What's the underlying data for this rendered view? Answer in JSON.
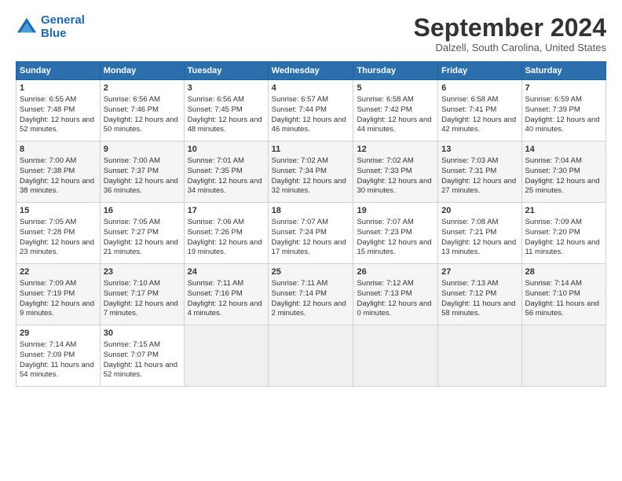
{
  "logo": {
    "line1": "General",
    "line2": "Blue"
  },
  "title": "September 2024",
  "location": "Dalzell, South Carolina, United States",
  "headers": [
    "Sunday",
    "Monday",
    "Tuesday",
    "Wednesday",
    "Thursday",
    "Friday",
    "Saturday"
  ],
  "rows": [
    [
      {
        "day": "1",
        "sunrise": "6:55 AM",
        "sunset": "7:48 PM",
        "daylight": "12 hours and 52 minutes."
      },
      {
        "day": "2",
        "sunrise": "6:56 AM",
        "sunset": "7:46 PM",
        "daylight": "12 hours and 50 minutes."
      },
      {
        "day": "3",
        "sunrise": "6:56 AM",
        "sunset": "7:45 PM",
        "daylight": "12 hours and 48 minutes."
      },
      {
        "day": "4",
        "sunrise": "6:57 AM",
        "sunset": "7:44 PM",
        "daylight": "12 hours and 46 minutes."
      },
      {
        "day": "5",
        "sunrise": "6:58 AM",
        "sunset": "7:42 PM",
        "daylight": "12 hours and 44 minutes."
      },
      {
        "day": "6",
        "sunrise": "6:58 AM",
        "sunset": "7:41 PM",
        "daylight": "12 hours and 42 minutes."
      },
      {
        "day": "7",
        "sunrise": "6:59 AM",
        "sunset": "7:39 PM",
        "daylight": "12 hours and 40 minutes."
      }
    ],
    [
      {
        "day": "8",
        "sunrise": "7:00 AM",
        "sunset": "7:38 PM",
        "daylight": "12 hours and 38 minutes."
      },
      {
        "day": "9",
        "sunrise": "7:00 AM",
        "sunset": "7:37 PM",
        "daylight": "12 hours and 36 minutes."
      },
      {
        "day": "10",
        "sunrise": "7:01 AM",
        "sunset": "7:35 PM",
        "daylight": "12 hours and 34 minutes."
      },
      {
        "day": "11",
        "sunrise": "7:02 AM",
        "sunset": "7:34 PM",
        "daylight": "12 hours and 32 minutes."
      },
      {
        "day": "12",
        "sunrise": "7:02 AM",
        "sunset": "7:33 PM",
        "daylight": "12 hours and 30 minutes."
      },
      {
        "day": "13",
        "sunrise": "7:03 AM",
        "sunset": "7:31 PM",
        "daylight": "12 hours and 27 minutes."
      },
      {
        "day": "14",
        "sunrise": "7:04 AM",
        "sunset": "7:30 PM",
        "daylight": "12 hours and 25 minutes."
      }
    ],
    [
      {
        "day": "15",
        "sunrise": "7:05 AM",
        "sunset": "7:28 PM",
        "daylight": "12 hours and 23 minutes."
      },
      {
        "day": "16",
        "sunrise": "7:05 AM",
        "sunset": "7:27 PM",
        "daylight": "12 hours and 21 minutes."
      },
      {
        "day": "17",
        "sunrise": "7:06 AM",
        "sunset": "7:26 PM",
        "daylight": "12 hours and 19 minutes."
      },
      {
        "day": "18",
        "sunrise": "7:07 AM",
        "sunset": "7:24 PM",
        "daylight": "12 hours and 17 minutes."
      },
      {
        "day": "19",
        "sunrise": "7:07 AM",
        "sunset": "7:23 PM",
        "daylight": "12 hours and 15 minutes."
      },
      {
        "day": "20",
        "sunrise": "7:08 AM",
        "sunset": "7:21 PM",
        "daylight": "12 hours and 13 minutes."
      },
      {
        "day": "21",
        "sunrise": "7:09 AM",
        "sunset": "7:20 PM",
        "daylight": "12 hours and 11 minutes."
      }
    ],
    [
      {
        "day": "22",
        "sunrise": "7:09 AM",
        "sunset": "7:19 PM",
        "daylight": "12 hours and 9 minutes."
      },
      {
        "day": "23",
        "sunrise": "7:10 AM",
        "sunset": "7:17 PM",
        "daylight": "12 hours and 7 minutes."
      },
      {
        "day": "24",
        "sunrise": "7:11 AM",
        "sunset": "7:16 PM",
        "daylight": "12 hours and 4 minutes."
      },
      {
        "day": "25",
        "sunrise": "7:11 AM",
        "sunset": "7:14 PM",
        "daylight": "12 hours and 2 minutes."
      },
      {
        "day": "26",
        "sunrise": "7:12 AM",
        "sunset": "7:13 PM",
        "daylight": "12 hours and 0 minutes."
      },
      {
        "day": "27",
        "sunrise": "7:13 AM",
        "sunset": "7:12 PM",
        "daylight": "11 hours and 58 minutes."
      },
      {
        "day": "28",
        "sunrise": "7:14 AM",
        "sunset": "7:10 PM",
        "daylight": "11 hours and 56 minutes."
      }
    ],
    [
      {
        "day": "29",
        "sunrise": "7:14 AM",
        "sunset": "7:09 PM",
        "daylight": "11 hours and 54 minutes."
      },
      {
        "day": "30",
        "sunrise": "7:15 AM",
        "sunset": "7:07 PM",
        "daylight": "11 hours and 52 minutes."
      },
      null,
      null,
      null,
      null,
      null
    ]
  ]
}
